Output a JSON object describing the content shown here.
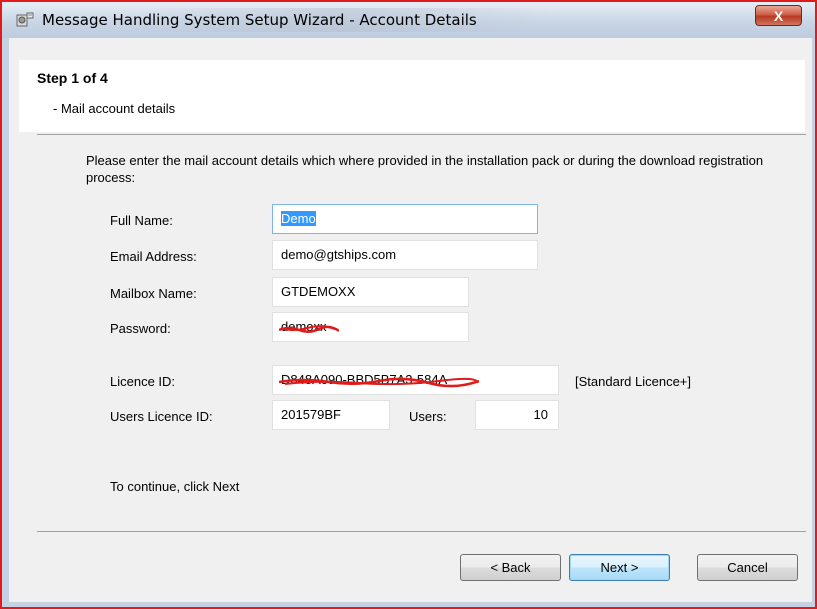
{
  "window": {
    "title": "Message Handling System Setup Wizard - Account Details",
    "close_glyph": "X"
  },
  "header": {
    "step": "Step 1 of 4",
    "substep": "- Mail account details"
  },
  "intro_text": "Please enter the mail account details which where provided in the installation pack or during the download registration process:",
  "form": {
    "full_name_label": "Full Name:",
    "full_name_value": "Demo",
    "email_label": "Email Address:",
    "email_value": "demo@gtships.com",
    "mailbox_label": "Mailbox Name:",
    "mailbox_value": "GTDEMOXX",
    "password_label": "Password:",
    "password_value": "demoxx",
    "licence_label": "Licence ID:",
    "licence_value": "D848A090-BBD5B7A3-584A",
    "licence_type": "[Standard Licence+]",
    "users_licence_label": "Users Licence ID:",
    "users_licence_value": "201579BF",
    "users_label": "Users:",
    "users_value": "10"
  },
  "continue_text": "To continue, click Next",
  "buttons": {
    "back": "< Back",
    "next": "Next >",
    "cancel": "Cancel"
  },
  "colors": {
    "redaction": "#e01b1b",
    "selection": "#3399ff",
    "window_border": "#c4d2e4"
  }
}
